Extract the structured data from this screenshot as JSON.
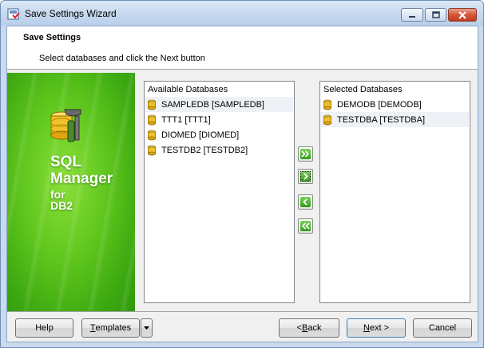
{
  "window": {
    "title": "Save Settings Wizard",
    "controls": {
      "minimize": "minimize-icon",
      "maximize": "maximize-icon",
      "close": "close-icon"
    }
  },
  "header": {
    "title": "Save Settings",
    "subtitle": "Select databases and click the Next button"
  },
  "banner": {
    "line1": "SQL",
    "line2": "Manager",
    "line3": "for",
    "line4": "DB2"
  },
  "available": {
    "caption": "Available Databases",
    "items": [
      {
        "label": "SAMPLEDB [SAMPLEDB]",
        "icon": "database-icon",
        "highlighted": true
      },
      {
        "label": "TTT1 [TTT1]",
        "icon": "database-icon"
      },
      {
        "label": "DIOMED [DIOMED]",
        "icon": "database-icon"
      },
      {
        "label": "TESTDB2 [TESTDB2]",
        "icon": "database-icon"
      }
    ]
  },
  "selected": {
    "caption": "Selected Databases",
    "items": [
      {
        "label": "DEMODB [DEMODB]",
        "icon": "database-icon"
      },
      {
        "label": "TESTDBA [TESTDBA]",
        "icon": "database-icon",
        "highlighted": true
      }
    ]
  },
  "move_buttons": {
    "add_all": "double-chevron-right-icon",
    "add": "chevron-right-icon",
    "remove": "chevron-left-icon",
    "remove_all": "double-chevron-left-icon"
  },
  "footer": {
    "help": "Help",
    "templates_prefix": "",
    "templates_mnemonic": "T",
    "templates_rest": "emplates",
    "back_prefix": "< ",
    "back_mnemonic": "B",
    "back_rest": "ack",
    "next_mnemonic": "N",
    "next_rest": "ext >",
    "cancel": "Cancel"
  },
  "colors": {
    "accent_green": "#5dc51c",
    "titlebar": "#c7d9ef",
    "close_red": "#d6573a"
  }
}
